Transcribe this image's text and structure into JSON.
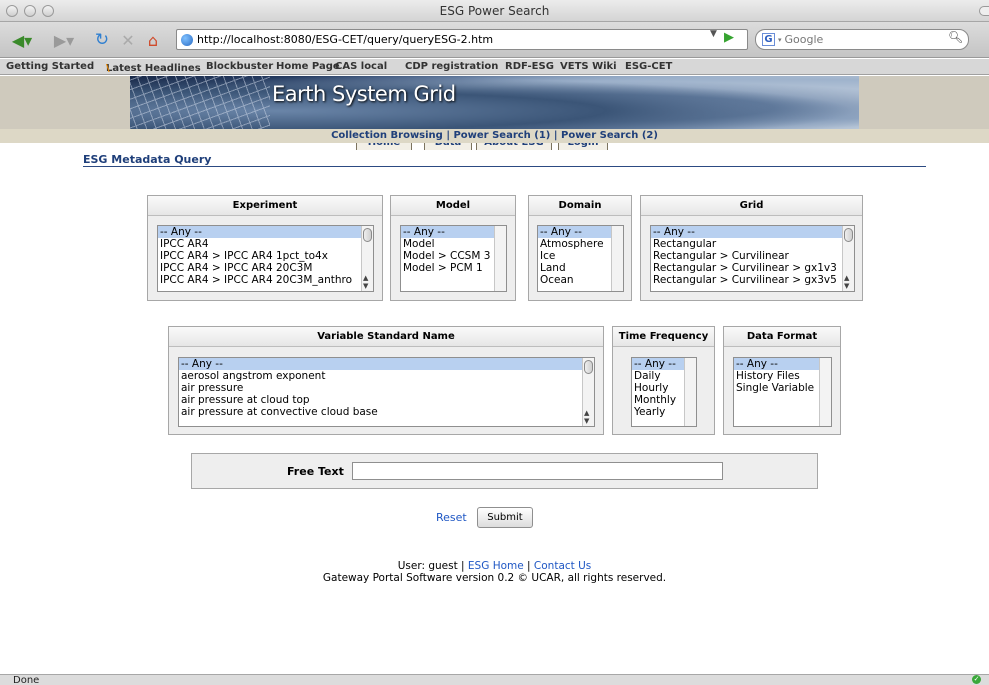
{
  "window": {
    "title": "ESG Power Search"
  },
  "nav": {
    "url": "http://localhost:8080/ESG-CET/query/queryESG-2.htm",
    "search_placeholder": "Google",
    "search_engine_glyph": "G"
  },
  "bookmarks": [
    "Getting Started",
    "Latest Headlines",
    "Blockbuster",
    "Home Page",
    "CAS local",
    "CDP registration",
    "RDF-ESG",
    "VETS Wiki",
    "ESG-CET"
  ],
  "banner": {
    "title": "Earth System Grid",
    "tabs": [
      "Home",
      "Data",
      "About ESG",
      "Login"
    ],
    "subnav": "Collection Browsing | Power Search (1) | Power Search (2)"
  },
  "page": {
    "heading": "ESG Metadata Query"
  },
  "filters": {
    "experiment": {
      "label": "Experiment",
      "options": [
        "-- Any --",
        "IPCC AR4",
        "IPCC AR4 > IPCC AR4 1pct_to4x",
        "IPCC AR4 > IPCC AR4 20C3M",
        "IPCC AR4 > IPCC AR4 20C3M_anthro"
      ]
    },
    "model": {
      "label": "Model",
      "options": [
        "-- Any --",
        "Model",
        "Model > CCSM 3",
        "Model > PCM 1"
      ]
    },
    "domain": {
      "label": "Domain",
      "options": [
        "-- Any --",
        "Atmosphere",
        "Ice",
        "Land",
        "Ocean"
      ]
    },
    "grid": {
      "label": "Grid",
      "options": [
        "-- Any --",
        "Rectangular",
        "Rectangular > Curvilinear",
        "Rectangular > Curvilinear > gx1v3",
        "Rectangular > Curvilinear > gx3v5"
      ]
    },
    "variable": {
      "label": "Variable Standard Name",
      "options": [
        "-- Any --",
        "aerosol angstrom exponent",
        "air pressure",
        "air pressure at cloud top",
        "air pressure at convective cloud base"
      ]
    },
    "frequency": {
      "label": "Time Frequency",
      "options": [
        "-- Any --",
        "Daily",
        "Hourly",
        "Monthly",
        "Yearly"
      ]
    },
    "format": {
      "label": "Data Format",
      "options": [
        "-- Any --",
        "History Files",
        "Single Variable"
      ]
    }
  },
  "freetext": {
    "label": "Free Text",
    "value": ""
  },
  "actions": {
    "reset": "Reset",
    "submit": "Submit"
  },
  "footer": {
    "user_prefix": "User: guest | ",
    "esg_home": "ESG Home",
    "separator": " | ",
    "contact": "Contact Us",
    "copyright": "Gateway Portal Software version 0.2 © UCAR, all rights reserved."
  },
  "status": {
    "text": "Done"
  }
}
